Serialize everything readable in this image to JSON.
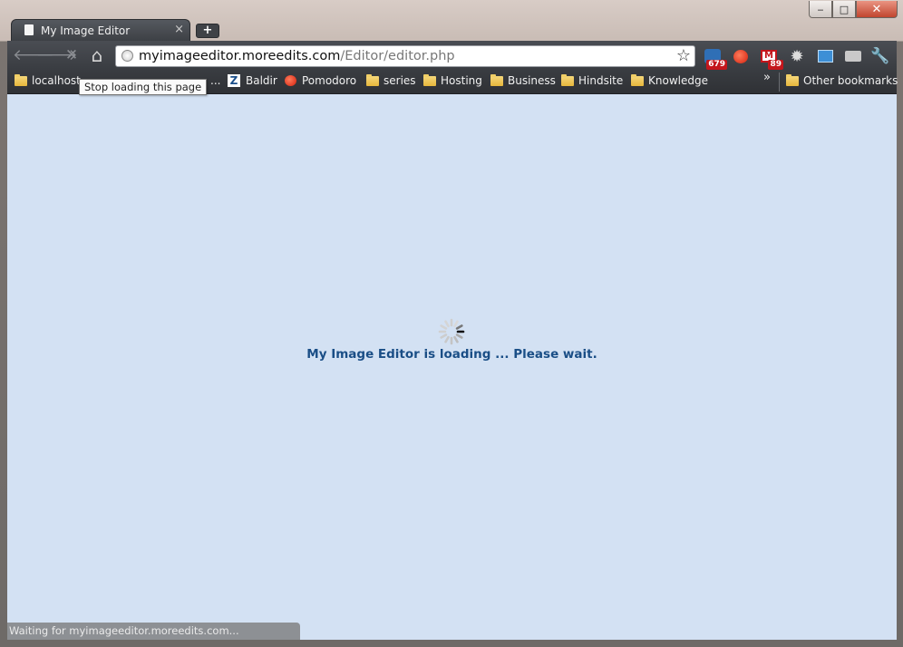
{
  "window": {
    "tab_title": "My Image Editor",
    "tab_close": "×",
    "new_tab": "+",
    "min": "‒",
    "max": "□",
    "close": "✕"
  },
  "toolbar": {
    "back": "🡐",
    "forward": "🡒",
    "stop": "✕",
    "home": "⌂",
    "url_host": "myimageeditor.moreedits.com",
    "url_path": "/Editor/editor.php",
    "star": "☆",
    "extensions": [
      {
        "name": "rss-icon",
        "badge": "679"
      },
      {
        "name": "tomato-icon",
        "badge": ""
      },
      {
        "name": "gmail-icon",
        "badge": "89"
      },
      {
        "name": "gear-icon",
        "badge": ""
      },
      {
        "name": "window-icon",
        "badge": ""
      },
      {
        "name": "printer-icon",
        "badge": ""
      },
      {
        "name": "wrench-icon",
        "badge": ""
      }
    ]
  },
  "bookmarks": {
    "items": [
      {
        "label": "localhost",
        "icon": "folder"
      },
      {
        "label": "...",
        "icon": "none"
      },
      {
        "label": "Baldir",
        "icon": "z"
      },
      {
        "label": "Pomodoro",
        "icon": "tomato"
      },
      {
        "label": "series",
        "icon": "folder"
      },
      {
        "label": "Hosting",
        "icon": "folder"
      },
      {
        "label": "Business",
        "icon": "folder"
      },
      {
        "label": "Hindsite",
        "icon": "folder"
      },
      {
        "label": "Knowledge",
        "icon": "folder"
      }
    ],
    "overflow": "»",
    "other": "Other bookmarks"
  },
  "tooltip": "Stop loading this page",
  "content": {
    "loading_text": "My Image Editor is loading ... Please wait."
  },
  "status": "Waiting for myimageeditor.moreedits.com..."
}
